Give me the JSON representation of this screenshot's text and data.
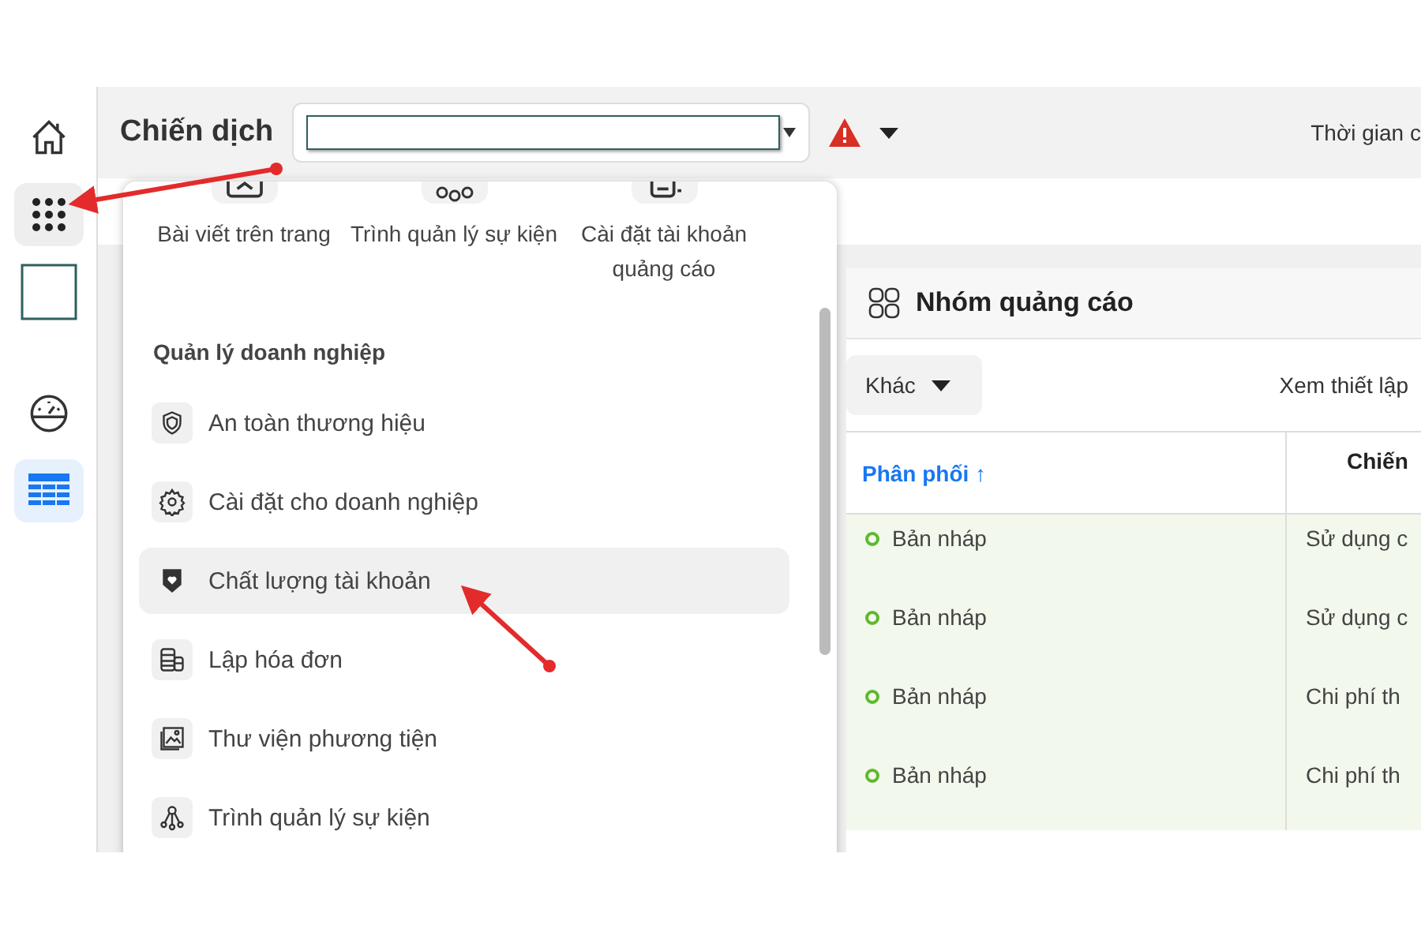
{
  "sidebar": {
    "items": [
      {
        "kind": "home",
        "selected": false,
        "pressed": false
      },
      {
        "kind": "apps",
        "selected": false,
        "pressed": true
      },
      {
        "kind": "account",
        "selected": false,
        "pressed": false
      },
      {
        "kind": "gauge",
        "selected": false,
        "pressed": false
      },
      {
        "kind": "table",
        "selected": true,
        "pressed": false
      }
    ]
  },
  "top_bar": {
    "title": "Chiến dịch",
    "time_label": "Thời gian c"
  },
  "menu": {
    "shortcuts": [
      {
        "kind": "post",
        "label": "Bài viết trên trang"
      },
      {
        "kind": "events",
        "label": "Trình quản lý sự kiện"
      },
      {
        "kind": "settings",
        "label": "Cài đặt tài khoản quảng cáo"
      }
    ],
    "section_title": "Quản lý doanh nghiệp",
    "items": [
      {
        "kind": "shield",
        "label": "An toàn thương hiệu",
        "selected": false
      },
      {
        "kind": "gear",
        "label": "Cài đặt cho doanh nghiệp",
        "selected": false
      },
      {
        "kind": "badge",
        "label": "Chất lượng tài khoản",
        "selected": true
      },
      {
        "kind": "coins",
        "label": "Lập hóa đơn",
        "selected": false
      },
      {
        "kind": "media",
        "label": "Thư viện phương tiện",
        "selected": false
      },
      {
        "kind": "events",
        "label": "Trình quản lý sự kiện",
        "selected": false
      }
    ]
  },
  "card": {
    "title": "Nhóm quảng cáo",
    "more_button": "Khác",
    "view_setup": "Xem thiết lập",
    "columns": [
      "Phân phối ↑",
      "Chiến"
    ],
    "rows": [
      {
        "status": "Bản nháp",
        "column_2": "Sử dụng c"
      },
      {
        "status": "Bản nháp",
        "column_2": "Sử dụng c"
      },
      {
        "status": "Bản nháp",
        "column_2": "Chi phí th"
      },
      {
        "status": "Bản nháp",
        "column_2": "Chi phí th"
      }
    ]
  }
}
